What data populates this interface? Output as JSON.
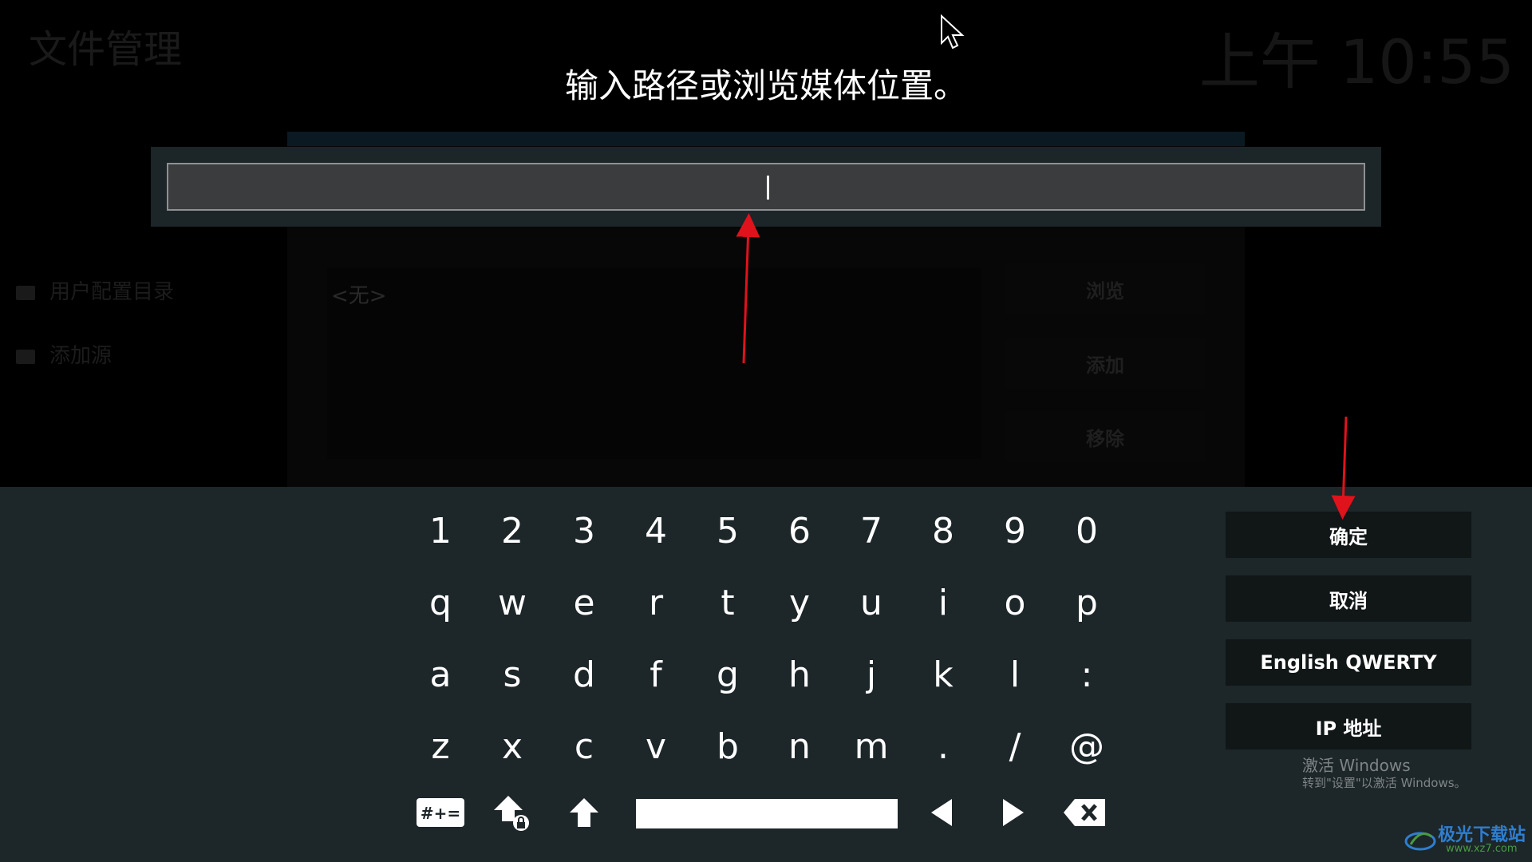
{
  "background": {
    "title": "文件管理",
    "clock": "上午 10:55",
    "sidebar": [
      "用户配置目录",
      "添加源"
    ],
    "list_empty": "<无>",
    "buttons": [
      "浏览",
      "添加",
      "移除"
    ]
  },
  "dialog": {
    "heading": "输入路径或浏览媒体位置。",
    "input_value": ""
  },
  "keyboard": {
    "rows": [
      [
        "1",
        "2",
        "3",
        "4",
        "5",
        "6",
        "7",
        "8",
        "9",
        "0"
      ],
      [
        "q",
        "w",
        "e",
        "r",
        "t",
        "y",
        "u",
        "i",
        "o",
        "p"
      ],
      [
        "a",
        "s",
        "d",
        "f",
        "g",
        "h",
        "j",
        "k",
        "l",
        ":"
      ],
      [
        "z",
        "x",
        "c",
        "v",
        "b",
        "n",
        "m",
        ".",
        "/",
        "@"
      ]
    ],
    "symbols_label": "#+="
  },
  "side_buttons": {
    "ok": "确定",
    "cancel": "取消",
    "layout": "English QWERTY",
    "ip": "IP 地址"
  },
  "watermark": {
    "line1": "激活 Windows",
    "line2": "转到\"设置\"以激活 Windows。"
  },
  "logo": {
    "text": "极光下载站",
    "url": "www.xz7.com"
  },
  "colors": {
    "keyboard_bg": "#1d2629",
    "annotation": "#e0121b"
  }
}
